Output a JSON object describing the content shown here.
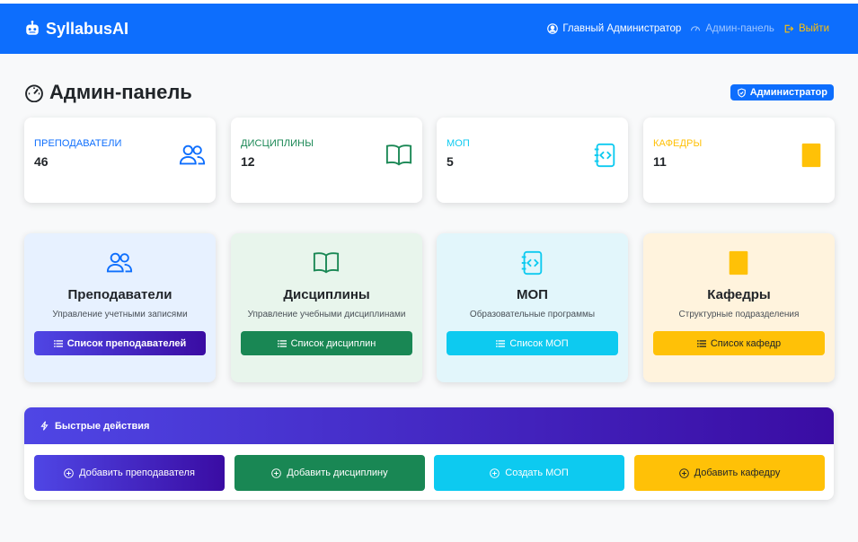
{
  "navbar": {
    "brand": "SyllabusAI",
    "user": "Главный Администратор",
    "admin_panel": "Админ-панель",
    "logout": "Выйти"
  },
  "page": {
    "title": "Админ-панель",
    "role_badge": "Администратор"
  },
  "stats": [
    {
      "label": "Преподаватели",
      "value": "46",
      "color": "#0d6efd",
      "icon": "people-icon"
    },
    {
      "label": "Дисциплины",
      "value": "12",
      "color": "#198754",
      "icon": "book-icon"
    },
    {
      "label": "МОП",
      "value": "5",
      "color": "#0dcaf0",
      "icon": "journal-code-icon"
    },
    {
      "label": "Кафедры",
      "value": "11",
      "color": "#ffc107",
      "icon": "building-icon"
    }
  ],
  "features": [
    {
      "title": "Преподаватели",
      "desc": "Управление учетными записями",
      "button": "Список преподавателей",
      "color": "#0d6efd",
      "bg": "#e7f1ff"
    },
    {
      "title": "Дисциплины",
      "desc": "Управление учебными дисциплинами",
      "button": "Список дисциплин",
      "color": "#198754",
      "bg": "#e8f5ec"
    },
    {
      "title": "МОП",
      "desc": "Образовательные программы",
      "button": "Список МОП",
      "color": "#0dcaf0",
      "bg": "#e2f6fb"
    },
    {
      "title": "Кафедры",
      "desc": "Структурные подразделения",
      "button": "Список кафедр",
      "color": "#ffc107",
      "bg": "#fff3dd"
    }
  ],
  "quick_actions": {
    "title": "Быстрые действия",
    "buttons": [
      {
        "label": "Добавить преподавателя",
        "color": "#4f46e5"
      },
      {
        "label": "Добавить дисциплину",
        "color": "#198754"
      },
      {
        "label": "Создать МОП",
        "color": "#0dcaf0"
      },
      {
        "label": "Добавить кафедру",
        "color": "#ffc107"
      }
    ]
  }
}
